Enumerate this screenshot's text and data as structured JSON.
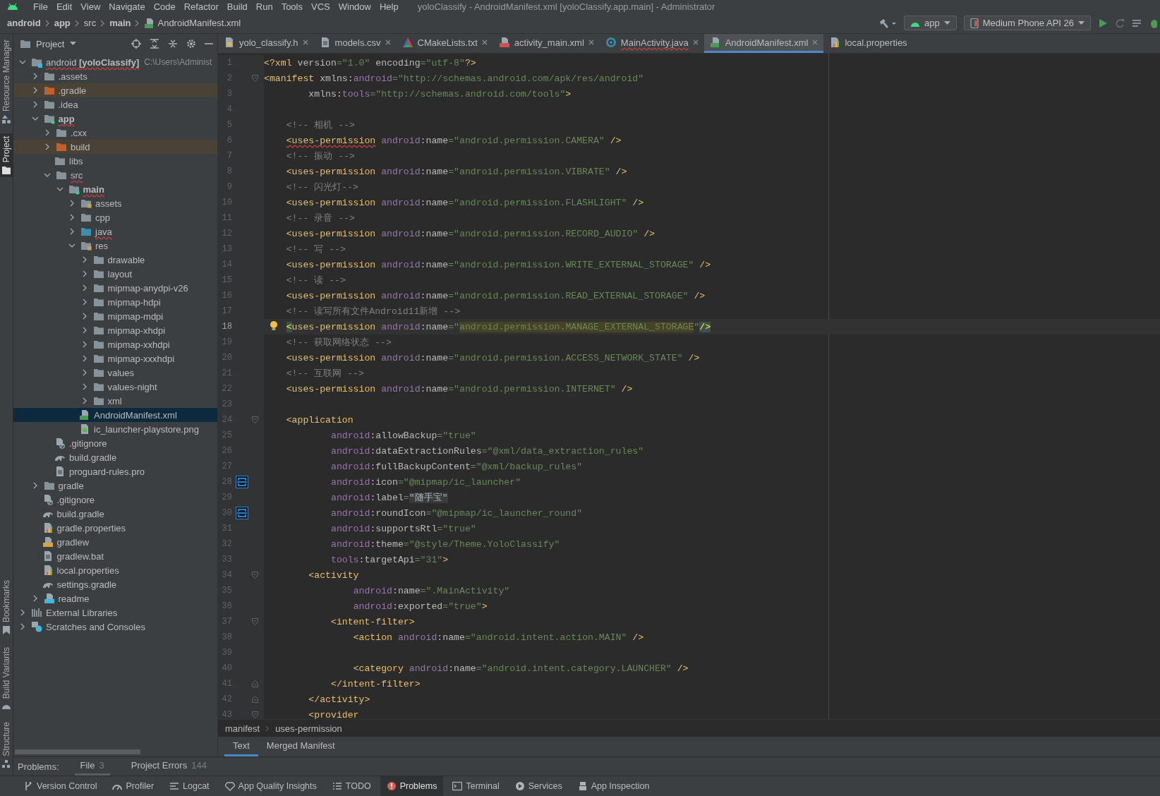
{
  "menu_bar": {
    "items": [
      "File",
      "Edit",
      "View",
      "Navigate",
      "Code",
      "Refactor",
      "Build",
      "Run",
      "Tools",
      "VCS",
      "Window",
      "Help"
    ],
    "title": "yoloClassify - AndroidManifest.xml [yoloClassify.app.main] - Administrator"
  },
  "nav_bar": {
    "crumbs": [
      {
        "label": "android",
        "bold": true,
        "kind": "dir"
      },
      {
        "label": "app",
        "bold": true,
        "kind": "dir"
      },
      {
        "label": "src",
        "bold": false,
        "kind": "dir"
      },
      {
        "label": "main",
        "bold": true,
        "kind": "dir"
      },
      {
        "label": "AndroidManifest.xml",
        "bold": false,
        "kind": "manifest"
      }
    ],
    "run_config": "app",
    "device": "Medium Phone API 26"
  },
  "side_strip": {
    "top": [
      {
        "label": "Resource Manager",
        "selected": false
      },
      {
        "label": "Project",
        "selected": true
      }
    ],
    "bottom": [
      {
        "label": "Bookmarks",
        "selected": false
      },
      {
        "label": "Build Variants",
        "selected": false
      },
      {
        "label": "Structure",
        "selected": false
      }
    ]
  },
  "project_panel": {
    "title": "Project",
    "tree": [
      {
        "label": "android **[yoloClassify]**",
        "hint": "C:\\Users\\Administ",
        "kind": "project",
        "expanded": true,
        "selected": false,
        "misspelled": true,
        "children": [
          {
            "label": ".assets",
            "kind": "folder",
            "expanded": false,
            "selected": false
          },
          {
            "label": ".gradle",
            "kind": "excluded",
            "expanded": false,
            "selected": false
          },
          {
            "label": ".idea",
            "kind": "folder",
            "expanded": false,
            "selected": false
          },
          {
            "label": "app",
            "kind": "module",
            "expanded": true,
            "selected": false,
            "bold": true,
            "misspelled": true,
            "children": [
              {
                "label": ".cxx",
                "kind": "folder",
                "expanded": false,
                "selected": false
              },
              {
                "label": "build",
                "kind": "excluded",
                "expanded": false,
                "selected": false
              },
              {
                "label": "libs",
                "kind": "folder",
                "selected": false
              },
              {
                "label": "src",
                "kind": "folder",
                "expanded": true,
                "selected": false,
                "misspelled": true,
                "children": [
                  {
                    "label": "main",
                    "kind": "module",
                    "expanded": true,
                    "selected": false,
                    "bold": true,
                    "misspelled": true,
                    "children": [
                      {
                        "label": "assets",
                        "kind": "res",
                        "expanded": false,
                        "selected": false
                      },
                      {
                        "label": "cpp",
                        "kind": "folder",
                        "expanded": false,
                        "selected": false
                      },
                      {
                        "label": "java",
                        "kind": "java",
                        "expanded": false,
                        "selected": false,
                        "misspelled": true
                      },
                      {
                        "label": "res",
                        "kind": "res",
                        "expanded": true,
                        "selected": false,
                        "children": [
                          {
                            "label": "drawable",
                            "kind": "folder",
                            "expanded": false,
                            "selected": false
                          },
                          {
                            "label": "layout",
                            "kind": "folder",
                            "expanded": false,
                            "selected": false
                          },
                          {
                            "label": "mipmap-anydpi-v26",
                            "kind": "folder",
                            "expanded": false,
                            "selected": false
                          },
                          {
                            "label": "mipmap-hdpi",
                            "kind": "folder",
                            "expanded": false,
                            "selected": false
                          },
                          {
                            "label": "mipmap-mdpi",
                            "kind": "folder",
                            "expanded": false,
                            "selected": false
                          },
                          {
                            "label": "mipmap-xhdpi",
                            "kind": "folder",
                            "expanded": false,
                            "selected": false
                          },
                          {
                            "label": "mipmap-xxhdpi",
                            "kind": "folder",
                            "expanded": false,
                            "selected": false
                          },
                          {
                            "label": "mipmap-xxxhdpi",
                            "kind": "folder",
                            "expanded": false,
                            "selected": false
                          },
                          {
                            "label": "values",
                            "kind": "folder",
                            "expanded": false,
                            "selected": false
                          },
                          {
                            "label": "values-night",
                            "kind": "folder",
                            "expanded": false,
                            "selected": false
                          },
                          {
                            "label": "xml",
                            "kind": "folder",
                            "expanded": false,
                            "selected": false
                          }
                        ]
                      },
                      {
                        "label": "AndroidManifest.xml",
                        "kind": "manifest",
                        "selected": true
                      },
                      {
                        "label": "ic_launcher-playstore.png",
                        "kind": "image",
                        "selected": false
                      }
                    ]
                  }
                ]
              },
              {
                "label": ".gitignore",
                "kind": "ignore",
                "selected": false
              },
              {
                "label": "build.gradle",
                "kind": "gradle",
                "selected": false
              },
              {
                "label": "proguard-rules.pro",
                "kind": "text",
                "selected": false
              }
            ]
          },
          {
            "label": "gradle",
            "kind": "folder",
            "expanded": false,
            "selected": false
          },
          {
            "label": ".gitignore",
            "kind": "ignore",
            "selected": false
          },
          {
            "label": "build.gradle",
            "kind": "gradle",
            "selected": false
          },
          {
            "label": "gradle.properties",
            "kind": "props",
            "selected": false
          },
          {
            "label": "gradlew",
            "kind": "script",
            "selected": false
          },
          {
            "label": "gradlew.bat",
            "kind": "text",
            "selected": false
          },
          {
            "label": "local.properties",
            "kind": "props",
            "selected": false
          },
          {
            "label": "settings.gradle",
            "kind": "gradle",
            "selected": false
          },
          {
            "label": "readme",
            "kind": "markdown",
            "expanded": false,
            "selected": false
          }
        ]
      },
      {
        "label": "External Libraries",
        "kind": "libraries",
        "expanded": false,
        "selected": false
      },
      {
        "label": "Scratches and Consoles",
        "kind": "scratches",
        "expanded": false,
        "selected": false
      }
    ]
  },
  "editor_tabs": [
    {
      "label": "yolo_classify.h",
      "kind": "header",
      "selected": false,
      "error": false,
      "closable": true
    },
    {
      "label": "models.csv",
      "kind": "text",
      "selected": false,
      "error": false,
      "closable": true
    },
    {
      "label": "CMakeLists.txt",
      "kind": "cmake",
      "selected": false,
      "error": false,
      "closable": true
    },
    {
      "label": "activity_main.xml",
      "kind": "layout",
      "selected": false,
      "error": false,
      "closable": true
    },
    {
      "label": "MainActivity.java",
      "kind": "class",
      "selected": false,
      "error": true,
      "closable": true
    },
    {
      "label": "AndroidManifest.xml",
      "kind": "manifest",
      "selected": true,
      "error": false,
      "closable": true
    },
    {
      "label": "local.properties",
      "kind": "props",
      "selected": false,
      "error": false,
      "closable": false
    }
  ],
  "editor": {
    "lines": [
      {
        "number": "1",
        "kind": "plain",
        "current": false,
        "tokens": [
          {
            "kind": "tag",
            "text": "<?xml"
          },
          {
            "kind": "attr",
            "text": " version"
          },
          {
            "kind": "value",
            "text": "=\"1.0\""
          },
          {
            "kind": "attr",
            "text": " encoding"
          },
          {
            "kind": "value",
            "text": "=\"utf-8\""
          },
          {
            "kind": "tag",
            "text": "?>"
          }
        ]
      },
      {
        "number": "2",
        "kind": "fold-start",
        "current": false,
        "tokens": [
          {
            "kind": "tag",
            "text": "<manifest"
          },
          {
            "kind": "attr",
            "text": " xmlns:"
          },
          {
            "kind": "ns",
            "text": "android"
          },
          {
            "kind": "value",
            "text": "=\"http://schemas.android.com/apk/res/android\""
          }
        ]
      },
      {
        "number": "3",
        "kind": "plain",
        "current": false,
        "tokens": [
          {
            "kind": "attr",
            "text": "        xmlns:"
          },
          {
            "kind": "ns",
            "text": "tools"
          },
          {
            "kind": "value",
            "text": "=\"http://schemas.android.com/tools\""
          },
          {
            "kind": "tag",
            "text": ">"
          }
        ]
      },
      {
        "number": "4",
        "kind": "plain",
        "current": false
      },
      {
        "number": "5",
        "kind": "plain",
        "current": false,
        "tokens": [
          {
            "kind": "comment",
            "text": "    <!-- 相机 -->"
          }
        ]
      },
      {
        "number": "6",
        "kind": "plain",
        "current": false,
        "tokens": [
          {
            "kind": "tag-error",
            "text": "    <uses-permission"
          },
          {
            "kind": "ns",
            "text": " android"
          },
          {
            "kind": "attr",
            "text": ":name"
          },
          {
            "kind": "value",
            "text": "=\"android.permission.CAMERA\""
          },
          {
            "kind": "tag",
            "text": " />"
          }
        ]
      },
      {
        "number": "7",
        "kind": "plain",
        "current": false,
        "tokens": [
          {
            "kind": "comment",
            "text": "    <!-- 振动 -->"
          }
        ]
      },
      {
        "number": "8",
        "kind": "plain",
        "current": false,
        "tokens": [
          {
            "kind": "tag",
            "text": "    <uses-permission"
          },
          {
            "kind": "ns",
            "text": " android"
          },
          {
            "kind": "attr",
            "text": ":name"
          },
          {
            "kind": "value",
            "text": "=\"android.permission.VIBRATE\""
          },
          {
            "kind": "tag",
            "text": " />"
          }
        ]
      },
      {
        "number": "9",
        "kind": "plain",
        "current": false,
        "tokens": [
          {
            "kind": "comment",
            "text": "    <!-- 闪光灯-->"
          }
        ]
      },
      {
        "number": "10",
        "kind": "plain",
        "current": false,
        "tokens": [
          {
            "kind": "tag",
            "text": "    <uses-permission"
          },
          {
            "kind": "ns",
            "text": " android"
          },
          {
            "kind": "attr",
            "text": ":name"
          },
          {
            "kind": "value",
            "text": "=\"android.permission.FLASHLIGHT\""
          },
          {
            "kind": "tag",
            "text": " />"
          }
        ]
      },
      {
        "number": "11",
        "kind": "plain",
        "current": false,
        "tokens": [
          {
            "kind": "comment",
            "text": "    <!-- 录音 -->"
          }
        ]
      },
      {
        "number": "12",
        "kind": "plain",
        "current": false,
        "tokens": [
          {
            "kind": "tag",
            "text": "    <uses-permission"
          },
          {
            "kind": "ns",
            "text": " android"
          },
          {
            "kind": "attr",
            "text": ":name"
          },
          {
            "kind": "value",
            "text": "=\"android.permission.RECORD_AUDIO\""
          },
          {
            "kind": "tag",
            "text": " />"
          }
        ]
      },
      {
        "number": "13",
        "kind": "plain",
        "current": false,
        "tokens": [
          {
            "kind": "comment",
            "text": "    <!-- 写 -->"
          }
        ]
      },
      {
        "number": "14",
        "kind": "plain",
        "current": false,
        "tokens": [
          {
            "kind": "tag",
            "text": "    <uses-permission"
          },
          {
            "kind": "ns",
            "text": " android"
          },
          {
            "kind": "attr",
            "text": ":name"
          },
          {
            "kind": "value",
            "text": "=\"android.permission.WRITE_EXTERNAL_STORAGE\""
          },
          {
            "kind": "tag",
            "text": " />"
          }
        ]
      },
      {
        "number": "15",
        "kind": "plain",
        "current": false,
        "tokens": [
          {
            "kind": "comment",
            "text": "    <!-- 读 -->"
          }
        ]
      },
      {
        "number": "16",
        "kind": "plain",
        "current": false,
        "tokens": [
          {
            "kind": "tag",
            "text": "    <uses-permission"
          },
          {
            "kind": "ns",
            "text": " android"
          },
          {
            "kind": "attr",
            "text": ":name"
          },
          {
            "kind": "value",
            "text": "=\"android.permission.READ_EXTERNAL_STORAGE\""
          },
          {
            "kind": "tag",
            "text": " />"
          }
        ]
      },
      {
        "number": "17",
        "kind": "plain",
        "current": false,
        "tokens": [
          {
            "kind": "comment",
            "text": "    <!-- 读写所有文件Android11新增 -->"
          }
        ]
      },
      {
        "number": "18",
        "kind": "bulb",
        "current": true,
        "tokens": [
          {
            "kind": "tag-brace",
            "text": "    <"
          },
          {
            "kind": "tag",
            "text": "uses-permission"
          },
          {
            "kind": "ns",
            "text": " android"
          },
          {
            "kind": "attr",
            "text": ":name"
          },
          {
            "kind": "value",
            "text": "=\""
          },
          {
            "kind": "value-match",
            "text": "android.permission.MANAGE_EXTERNAL_STORAGE"
          },
          {
            "kind": "value",
            "text": "\""
          },
          {
            "kind": "tag-brace",
            "text": "/>"
          }
        ]
      },
      {
        "number": "19",
        "kind": "plain",
        "current": false,
        "tokens": [
          {
            "kind": "comment",
            "text": "    <!-- 获取网络状态 -->"
          }
        ]
      },
      {
        "number": "20",
        "kind": "plain",
        "current": false,
        "tokens": [
          {
            "kind": "tag",
            "text": "    <uses-permission"
          },
          {
            "kind": "ns",
            "text": " android"
          },
          {
            "kind": "attr",
            "text": ":name"
          },
          {
            "kind": "value",
            "text": "=\"android.permission.ACCESS_NETWORK_STATE\""
          },
          {
            "kind": "tag",
            "text": " />"
          }
        ]
      },
      {
        "number": "21",
        "kind": "plain",
        "current": false,
        "tokens": [
          {
            "kind": "comment",
            "text": "    <!-- 互联网 -->"
          }
        ]
      },
      {
        "number": "22",
        "kind": "plain",
        "current": false,
        "tokens": [
          {
            "kind": "tag",
            "text": "    <uses-permission"
          },
          {
            "kind": "ns",
            "text": " android"
          },
          {
            "kind": "attr",
            "text": ":name"
          },
          {
            "kind": "value",
            "text": "=\"android.permission.INTERNET\""
          },
          {
            "kind": "tag",
            "text": " />"
          }
        ]
      },
      {
        "number": "23",
        "kind": "plain",
        "current": false
      },
      {
        "number": "24",
        "kind": "fold-start",
        "current": false,
        "tokens": [
          {
            "kind": "tag",
            "text": "    <application"
          }
        ]
      },
      {
        "number": "25",
        "kind": "plain",
        "current": false,
        "tokens": [
          {
            "kind": "ns",
            "text": "            android"
          },
          {
            "kind": "attr",
            "text": ":allowBackup"
          },
          {
            "kind": "value",
            "text": "=\"true\""
          }
        ]
      },
      {
        "number": "26",
        "kind": "plain",
        "current": false,
        "tokens": [
          {
            "kind": "ns",
            "text": "            android"
          },
          {
            "kind": "attr",
            "text": ":dataExtractionRules"
          },
          {
            "kind": "value",
            "text": "=\"@xml/data_extraction_rules\""
          }
        ]
      },
      {
        "number": "27",
        "kind": "plain",
        "current": false,
        "tokens": [
          {
            "kind": "ns",
            "text": "            android"
          },
          {
            "kind": "attr",
            "text": ":fullBackupContent"
          },
          {
            "kind": "value",
            "text": "=\"@xml/backup_rules\""
          }
        ]
      },
      {
        "number": "28",
        "kind": "image",
        "current": false,
        "tokens": [
          {
            "kind": "ns",
            "text": "            android"
          },
          {
            "kind": "attr",
            "text": ":icon"
          },
          {
            "kind": "value",
            "text": "=\"@mipmap/ic_launcher\""
          }
        ]
      },
      {
        "number": "29",
        "kind": "plain",
        "current": false,
        "tokens": [
          {
            "kind": "ns",
            "text": "            android"
          },
          {
            "kind": "attr",
            "text": ":label"
          },
          {
            "kind": "value",
            "text": "="
          },
          {
            "kind": "value-folded",
            "text": "\"随手宝\""
          }
        ]
      },
      {
        "number": "30",
        "kind": "image",
        "current": false,
        "tokens": [
          {
            "kind": "ns",
            "text": "            android"
          },
          {
            "kind": "attr",
            "text": ":roundIcon"
          },
          {
            "kind": "value",
            "text": "=\"@mipmap/ic_launcher_round\""
          }
        ]
      },
      {
        "number": "31",
        "kind": "plain",
        "current": false,
        "tokens": [
          {
            "kind": "ns",
            "text": "            android"
          },
          {
            "kind": "attr",
            "text": ":supportsRtl"
          },
          {
            "kind": "value",
            "text": "=\"true\""
          }
        ]
      },
      {
        "number": "32",
        "kind": "plain",
        "current": false,
        "tokens": [
          {
            "kind": "ns",
            "text": "            android"
          },
          {
            "kind": "attr",
            "text": ":theme"
          },
          {
            "kind": "value",
            "text": "=\"@style/Theme.YoloClassify\""
          }
        ]
      },
      {
        "number": "33",
        "kind": "plain",
        "current": false,
        "tokens": [
          {
            "kind": "ns",
            "text": "            tools"
          },
          {
            "kind": "attr",
            "text": ":targetApi"
          },
          {
            "kind": "value",
            "text": "=\"31\""
          },
          {
            "kind": "tag",
            "text": ">"
          }
        ]
      },
      {
        "number": "34",
        "kind": "fold-start",
        "current": false,
        "tokens": [
          {
            "kind": "tag",
            "text": "        <activity"
          }
        ]
      },
      {
        "number": "35",
        "kind": "plain",
        "current": false,
        "tokens": [
          {
            "kind": "ns",
            "text": "                android"
          },
          {
            "kind": "attr",
            "text": ":name"
          },
          {
            "kind": "value",
            "text": "=\".MainActivity\""
          }
        ]
      },
      {
        "number": "36",
        "kind": "plain",
        "current": false,
        "tokens": [
          {
            "kind": "ns",
            "text": "                android"
          },
          {
            "kind": "attr",
            "text": ":exported"
          },
          {
            "kind": "value",
            "text": "=\"true\""
          },
          {
            "kind": "tag",
            "text": ">"
          }
        ]
      },
      {
        "number": "37",
        "kind": "fold-start",
        "current": false,
        "tokens": [
          {
            "kind": "tag",
            "text": "            <intent-filter>"
          }
        ]
      },
      {
        "number": "38",
        "kind": "plain",
        "current": false,
        "tokens": [
          {
            "kind": "tag",
            "text": "                <action"
          },
          {
            "kind": "ns",
            "text": " android"
          },
          {
            "kind": "attr",
            "text": ":name"
          },
          {
            "kind": "value",
            "text": "=\"android.intent.action.MAIN\""
          },
          {
            "kind": "tag",
            "text": " />"
          }
        ]
      },
      {
        "number": "39",
        "kind": "plain",
        "current": false
      },
      {
        "number": "40",
        "kind": "plain",
        "current": false,
        "tokens": [
          {
            "kind": "tag",
            "text": "                <category"
          },
          {
            "kind": "ns",
            "text": " android"
          },
          {
            "kind": "attr",
            "text": ":name"
          },
          {
            "kind": "value",
            "text": "=\"android.intent.category.LAUNCHER\""
          },
          {
            "kind": "tag",
            "text": " />"
          }
        ]
      },
      {
        "number": "41",
        "kind": "fold-end",
        "current": false,
        "tokens": [
          {
            "kind": "tag",
            "text": "            </intent-filter>"
          }
        ]
      },
      {
        "number": "42",
        "kind": "fold-end",
        "current": false,
        "tokens": [
          {
            "kind": "tag",
            "text": "        </activity>"
          }
        ]
      },
      {
        "number": "43",
        "kind": "fold-start",
        "current": false,
        "tokens": [
          {
            "kind": "tag",
            "text": "        <provider"
          }
        ]
      }
    ],
    "breadcrumbs": [
      "manifest",
      "uses-permission"
    ],
    "view_tabs": [
      {
        "label": "Text",
        "selected": true
      },
      {
        "label": "Merged Manifest",
        "selected": false
      }
    ]
  },
  "problems_bar": {
    "label": "Problems:",
    "tabs": [
      {
        "label": "File",
        "count": "3",
        "selected": true
      },
      {
        "label": "Project Errors",
        "count": "144",
        "selected": false
      }
    ]
  },
  "tool_bar": [
    {
      "label": "Version Control",
      "kind": "branch",
      "selected": false
    },
    {
      "label": "Profiler",
      "kind": "gauge",
      "selected": false
    },
    {
      "label": "Logcat",
      "kind": "lines",
      "selected": false
    },
    {
      "label": "App Quality Insights",
      "kind": "diamond",
      "selected": false
    },
    {
      "label": "TODO",
      "kind": "list",
      "selected": false
    },
    {
      "label": "Problems",
      "kind": "alert",
      "selected": true
    },
    {
      "label": "Terminal",
      "kind": "terminal",
      "selected": false
    },
    {
      "label": "Services",
      "kind": "play",
      "selected": false
    },
    {
      "label": "App Inspection",
      "kind": "inspect",
      "selected": false
    }
  ]
}
